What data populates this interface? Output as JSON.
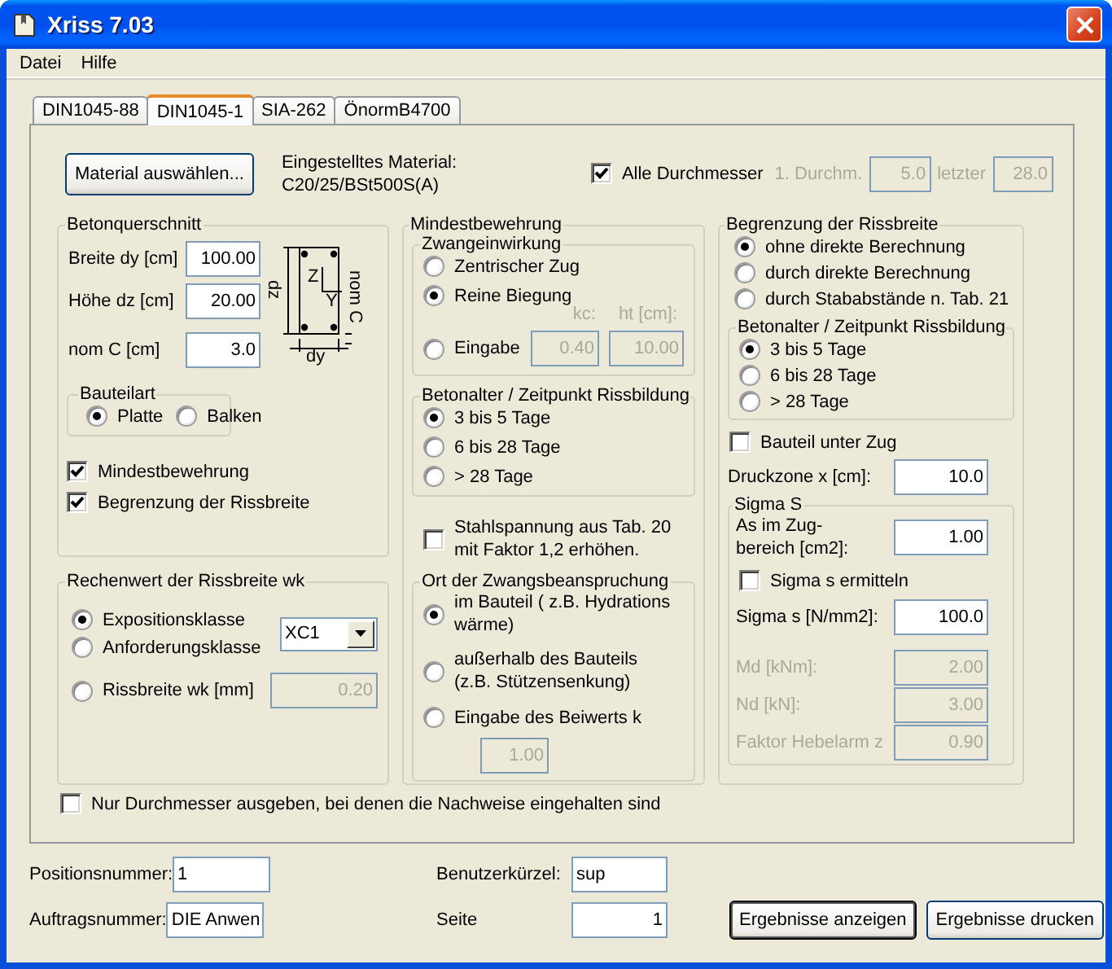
{
  "window": {
    "title": "Xriss 7.03"
  },
  "menu": [
    {
      "label": "Datei"
    },
    {
      "label": "Hilfe"
    }
  ],
  "tabs": [
    {
      "label": "DIN1045-88",
      "selected": false
    },
    {
      "label": "DIN1045-1",
      "selected": true
    },
    {
      "label": "SIA-262",
      "selected": false
    },
    {
      "label": "ÖnormB4700",
      "selected": false
    }
  ],
  "material": {
    "button": "Material auswählen...",
    "label": "Eingestelltes Material:",
    "value": "C20/25/BSt500S(A)"
  },
  "diameters": {
    "all": {
      "label": "Alle Durchmesser",
      "checked": true
    },
    "first": {
      "label": "1. Durchm.",
      "value": "5.0",
      "disabled": true
    },
    "last": {
      "label": "letzter",
      "value": "28.0",
      "disabled": true
    }
  },
  "section": {
    "title": "Betonquerschnitt",
    "fields": [
      {
        "label": "Breite dy [cm]",
        "value": "100.00"
      },
      {
        "label": "Höhe dz [cm]",
        "value": "20.00"
      },
      {
        "label": "nom C [cm]",
        "value": "3.0"
      }
    ],
    "diagram_labels": {
      "height": "dz",
      "z_axis": "Z",
      "y_axis": "Y",
      "cover": "nom C",
      "width": "dy"
    },
    "member_type": {
      "title": "Bauteilart",
      "options": [
        {
          "label": "Platte",
          "selected": true
        },
        {
          "label": "Balken",
          "selected": false
        }
      ]
    },
    "checks": [
      {
        "label": "Mindestbewehrung",
        "checked": true
      },
      {
        "label": "Begrenzung der Rissbreite",
        "checked": true
      }
    ]
  },
  "crack_width": {
    "title": "Rechenwert der Rissbreite wk",
    "options": [
      {
        "label": "Expositionsklasse",
        "selected": true
      },
      {
        "label": "Anforderungsklasse",
        "selected": false
      },
      {
        "label": "Rissbreite wk [mm]",
        "selected": false
      }
    ],
    "select": {
      "value": "XC1"
    },
    "wk": {
      "value": "0.20",
      "disabled": true
    }
  },
  "min_reinf": {
    "title": "Mindestbewehrung",
    "restraint": {
      "title": "Zwangeinwirkung",
      "options": [
        {
          "label": "Zentrischer Zug",
          "selected": false
        },
        {
          "label": "Reine Biegung",
          "selected": true
        },
        {
          "label": "Eingabe",
          "selected": false
        }
      ],
      "kc": {
        "label": "kc:",
        "value": "0.40",
        "disabled": true
      },
      "ht": {
        "label": "ht [cm]:",
        "value": "10.00",
        "disabled": true
      }
    },
    "age": {
      "title": "Betonalter / Zeitpunkt Rissbildung",
      "options": [
        {
          "label": "3 bis 5 Tage",
          "selected": true
        },
        {
          "label": "6 bis 28 Tage",
          "selected": false
        },
        {
          "label": "> 28 Tage",
          "selected": false
        }
      ]
    },
    "steel": {
      "label": "Stahlspannung aus Tab. 20\nmit Faktor 1,2 erhöhen.",
      "checked": false
    },
    "location": {
      "title": "Ort der Zwangsbeanspruchung",
      "options": [
        {
          "label": "im Bauteil ( z.B. Hydrations\nwärme)",
          "selected": true
        },
        {
          "label": "außerhalb des Bauteils\n(z.B. Stützensenkung)",
          "selected": false
        },
        {
          "label": "Eingabe des Beiwerts k",
          "selected": false
        }
      ],
      "k": {
        "value": "1.00",
        "disabled": true
      }
    }
  },
  "crack_limit": {
    "title": "Begrenzung der Rissbreite",
    "options": [
      {
        "label": "ohne direkte Berechnung",
        "selected": true
      },
      {
        "label": "durch direkte Berechnung",
        "selected": false
      },
      {
        "label": "durch Stababstände n. Tab. 21",
        "selected": false
      }
    ],
    "age": {
      "title": "Betonalter / Zeitpunkt Rissbildung",
      "options": [
        {
          "label": "3 bis 5 Tage",
          "selected": true
        },
        {
          "label": "6 bis 28 Tage",
          "selected": false
        },
        {
          "label": "> 28 Tage",
          "selected": false
        }
      ]
    },
    "tension": {
      "label": "Bauteil unter Zug",
      "checked": false
    },
    "compression": {
      "label": "Druckzone x [cm]:",
      "value": "10.0",
      "disabled": false
    },
    "sigma": {
      "title": "Sigma S",
      "as": {
        "label": "As im Zug-\nbereich [cm2]:",
        "value": "1.00",
        "disabled": false
      },
      "determine": {
        "label": "Sigma s ermitteln",
        "checked": false
      },
      "fields": [
        {
          "label": "Sigma s [N/mm2]:",
          "value": "100.0",
          "disabled": false
        },
        {
          "label": "Md [kNm]:",
          "value": "2.00",
          "disabled": true
        },
        {
          "label": "Nd [kN]:",
          "value": "3.00",
          "disabled": true
        },
        {
          "label": "Faktor Hebelarm z",
          "value": "0.90",
          "disabled": true
        }
      ]
    }
  },
  "only_valid": {
    "label": "Nur Durchmesser ausgeben, bei denen die Nachweise eingehalten sind",
    "checked": false
  },
  "footer": {
    "fields": [
      {
        "label": "Positionsnummer:",
        "value": "1",
        "kind": "text"
      },
      {
        "label": "Benutzerkürzel:",
        "value": "sup",
        "kind": "text"
      },
      {
        "label": "Auftragsnummer:",
        "value": "DIE Anwen",
        "kind": "text"
      },
      {
        "label": "Seite",
        "value": "1",
        "kind": "number"
      }
    ],
    "buttons": [
      {
        "label": "Ergebnisse anzeigen",
        "default": true
      },
      {
        "label": "Ergebnisse drucken",
        "default": false
      }
    ]
  }
}
